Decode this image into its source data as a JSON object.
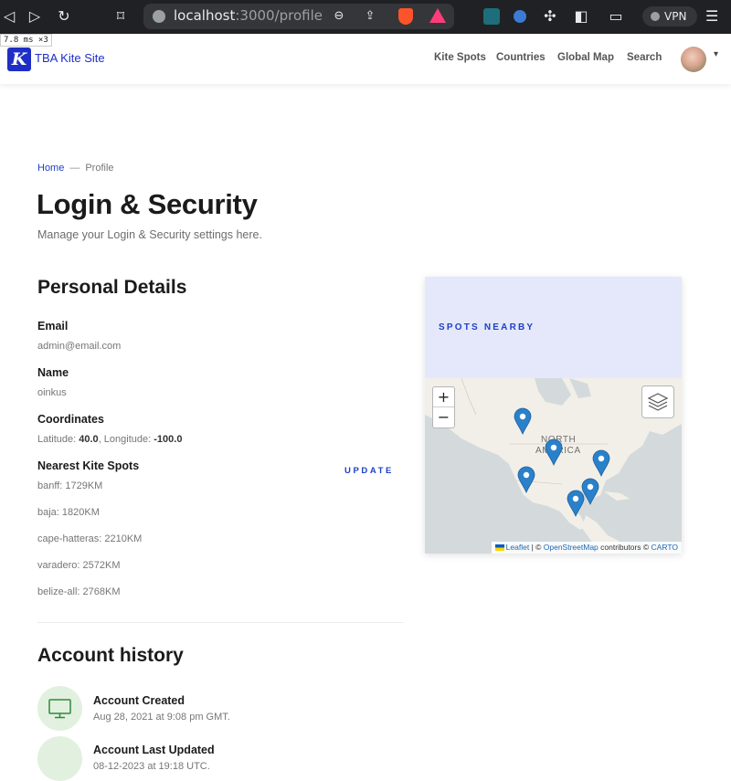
{
  "browser": {
    "url_host": "localhost",
    "url_rest": ":3000/profile",
    "vpn_label": "VPN",
    "perf_badge": "7.8 ms ×3"
  },
  "header": {
    "logo_letter": "K",
    "site_title": "TBA Kite Site",
    "nav": [
      "Kite Spots",
      "Countries",
      "Global Map",
      "Search"
    ]
  },
  "breadcrumb": {
    "home": "Home",
    "separator": "—",
    "current": "Profile"
  },
  "page": {
    "title": "Login & Security",
    "subtitle": "Manage your Login & Security settings here."
  },
  "personal": {
    "title": "Personal Details",
    "email_label": "Email",
    "email_value": "admin@email.com",
    "name_label": "Name",
    "name_value": "oinkus",
    "coords_label": "Coordinates",
    "lat_prefix": "Latitude: ",
    "lat_value": "40.0",
    "lon_prefix": ", Longitude: ",
    "lon_value": "-100.0",
    "spots_label": "Nearest Kite Spots",
    "update_label": "UPDATE",
    "spots": [
      "banff: 1729KM",
      "baja: 1820KM",
      "cape-hatteras: 2210KM",
      "varadero: 2572KM",
      "belize-all: 2768KM"
    ]
  },
  "map": {
    "title": "SPOTS NEARBY",
    "zoom_in": "+",
    "zoom_out": "−",
    "continent_line1": "NORTH",
    "continent_line2": "AMERICA",
    "attr_leaflet": "Leaflet",
    "attr_sep1": " | © ",
    "attr_osm": "OpenStreetMap",
    "attr_mid": " contributors © ",
    "attr_carto": "CARTO",
    "land_color": "#f2efe9",
    "water_color": "#d4dadc",
    "marker_color": "#2a81cb"
  },
  "history": {
    "title": "Account history",
    "items": [
      {
        "title": "Account Created",
        "subtitle": "Aug 28, 2021 at 9:08 pm GMT."
      },
      {
        "title": "Account Last Updated",
        "subtitle": "08-12-2023 at 19:18 UTC."
      }
    ]
  }
}
